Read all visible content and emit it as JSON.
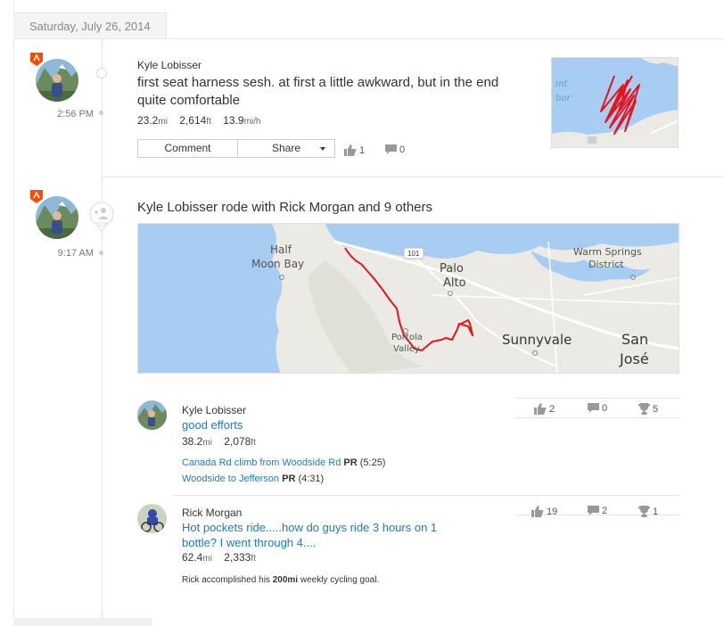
{
  "date_header": "Saturday, July 26, 2014",
  "activity1": {
    "athlete": "Kyle Lobisser",
    "time": "2:56 PM",
    "title": "first seat harness sesh. at first a little awkward, but in the end quite comfortable",
    "distance": "23.2",
    "distance_unit": "mi",
    "elevation": "2,614",
    "elevation_unit": "ft",
    "speed": "13.9",
    "speed_unit": "mi/h",
    "comment_label": "Comment",
    "share_label": "Share",
    "kudos": "1",
    "comments": "0",
    "map_text_1": "int",
    "map_text_2": "bor"
  },
  "group": {
    "time": "9:17 AM",
    "title": "Kyle Lobisser rode with Rick Morgan and 9 others",
    "map_labels": {
      "half_moon_bay_1": "Half",
      "half_moon_bay_2": "Moon Bay",
      "palo_alto_1": "Palo",
      "palo_alto_2": "Alto",
      "warm_springs_1": "Warm Springs",
      "warm_springs_2": "District",
      "portola_1": "Portola",
      "portola_2": "Valley",
      "sunnyvale": "Sunnyvale",
      "san_jose_1": "San",
      "san_jose_2": "José",
      "hwy": "101"
    },
    "entries": [
      {
        "athlete": "Kyle Lobisser",
        "title": "good efforts",
        "distance": "38.2",
        "distance_unit": "mi",
        "elevation": "2,078",
        "elevation_unit": "ft",
        "kudos": "2",
        "comments": "0",
        "achievements": "5",
        "segments": [
          {
            "name": "Canada Rd climb from Woodside Rd",
            "pr": "PR",
            "time": "(5:25)"
          },
          {
            "name": "Woodside to Jefferson",
            "pr": "PR",
            "time": "(4:31)"
          }
        ]
      },
      {
        "athlete": "Rick Morgan",
        "title_line1": "Hot pockets ride.....how do guys ride 3 hours on 1",
        "title_line2": "bottle? I went through 4....",
        "distance": "62.4",
        "distance_unit": "mi",
        "elevation": "2,333",
        "elevation_unit": "ft",
        "kudos": "19",
        "comments": "2",
        "achievements": "1",
        "goal_pre": "Rick accomplished his",
        "goal_bold": "200mi",
        "goal_post": "weekly cycling goal."
      }
    ]
  },
  "colors": {
    "link": "#1e7ab8",
    "route": "#e8121b",
    "water": "#a7cdf2",
    "land": "#eceae4",
    "badge": "#fc4c02"
  }
}
